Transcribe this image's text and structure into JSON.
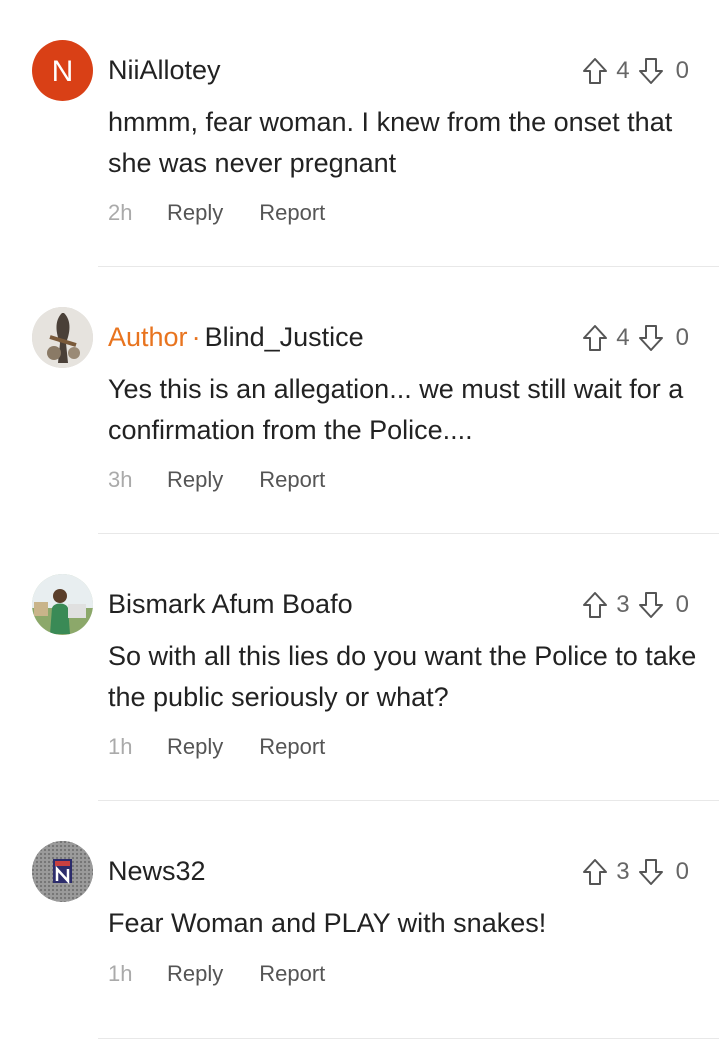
{
  "comments": [
    {
      "avatar_letter": "N",
      "avatar_color": "#d94016",
      "username": "NiiAllotey",
      "author_tag": "",
      "upvotes": "4",
      "downvotes": "0",
      "text": "hmmm, fear woman. I knew from the onset that she was never pregnant",
      "time": "2h",
      "reply_label": "Reply",
      "report_label": "Report"
    },
    {
      "username": "Blind_Justice",
      "author_tag": "Author",
      "author_dot": "·",
      "upvotes": "4",
      "downvotes": "0",
      "text": "Yes this is an allegation... we must still wait for a confirmation from the Police....",
      "time": "3h",
      "reply_label": "Reply",
      "report_label": "Report"
    },
    {
      "username": "Bismark Afum Boafo",
      "author_tag": "",
      "upvotes": "3",
      "downvotes": "0",
      "text": "So with all this lies do you want the Police to take the public seriously or what?",
      "time": "1h",
      "reply_label": "Reply",
      "report_label": "Report"
    },
    {
      "username": "News32",
      "author_tag": "",
      "upvotes": "3",
      "downvotes": "0",
      "text": "Fear Woman and PLAY with snakes!",
      "time": "1h",
      "reply_label": "Reply",
      "report_label": "Report"
    }
  ],
  "colors": {
    "author_accent": "#e8741f",
    "text": "#222222",
    "muted": "#aaaaaa",
    "divider": "#e8e8e8"
  }
}
